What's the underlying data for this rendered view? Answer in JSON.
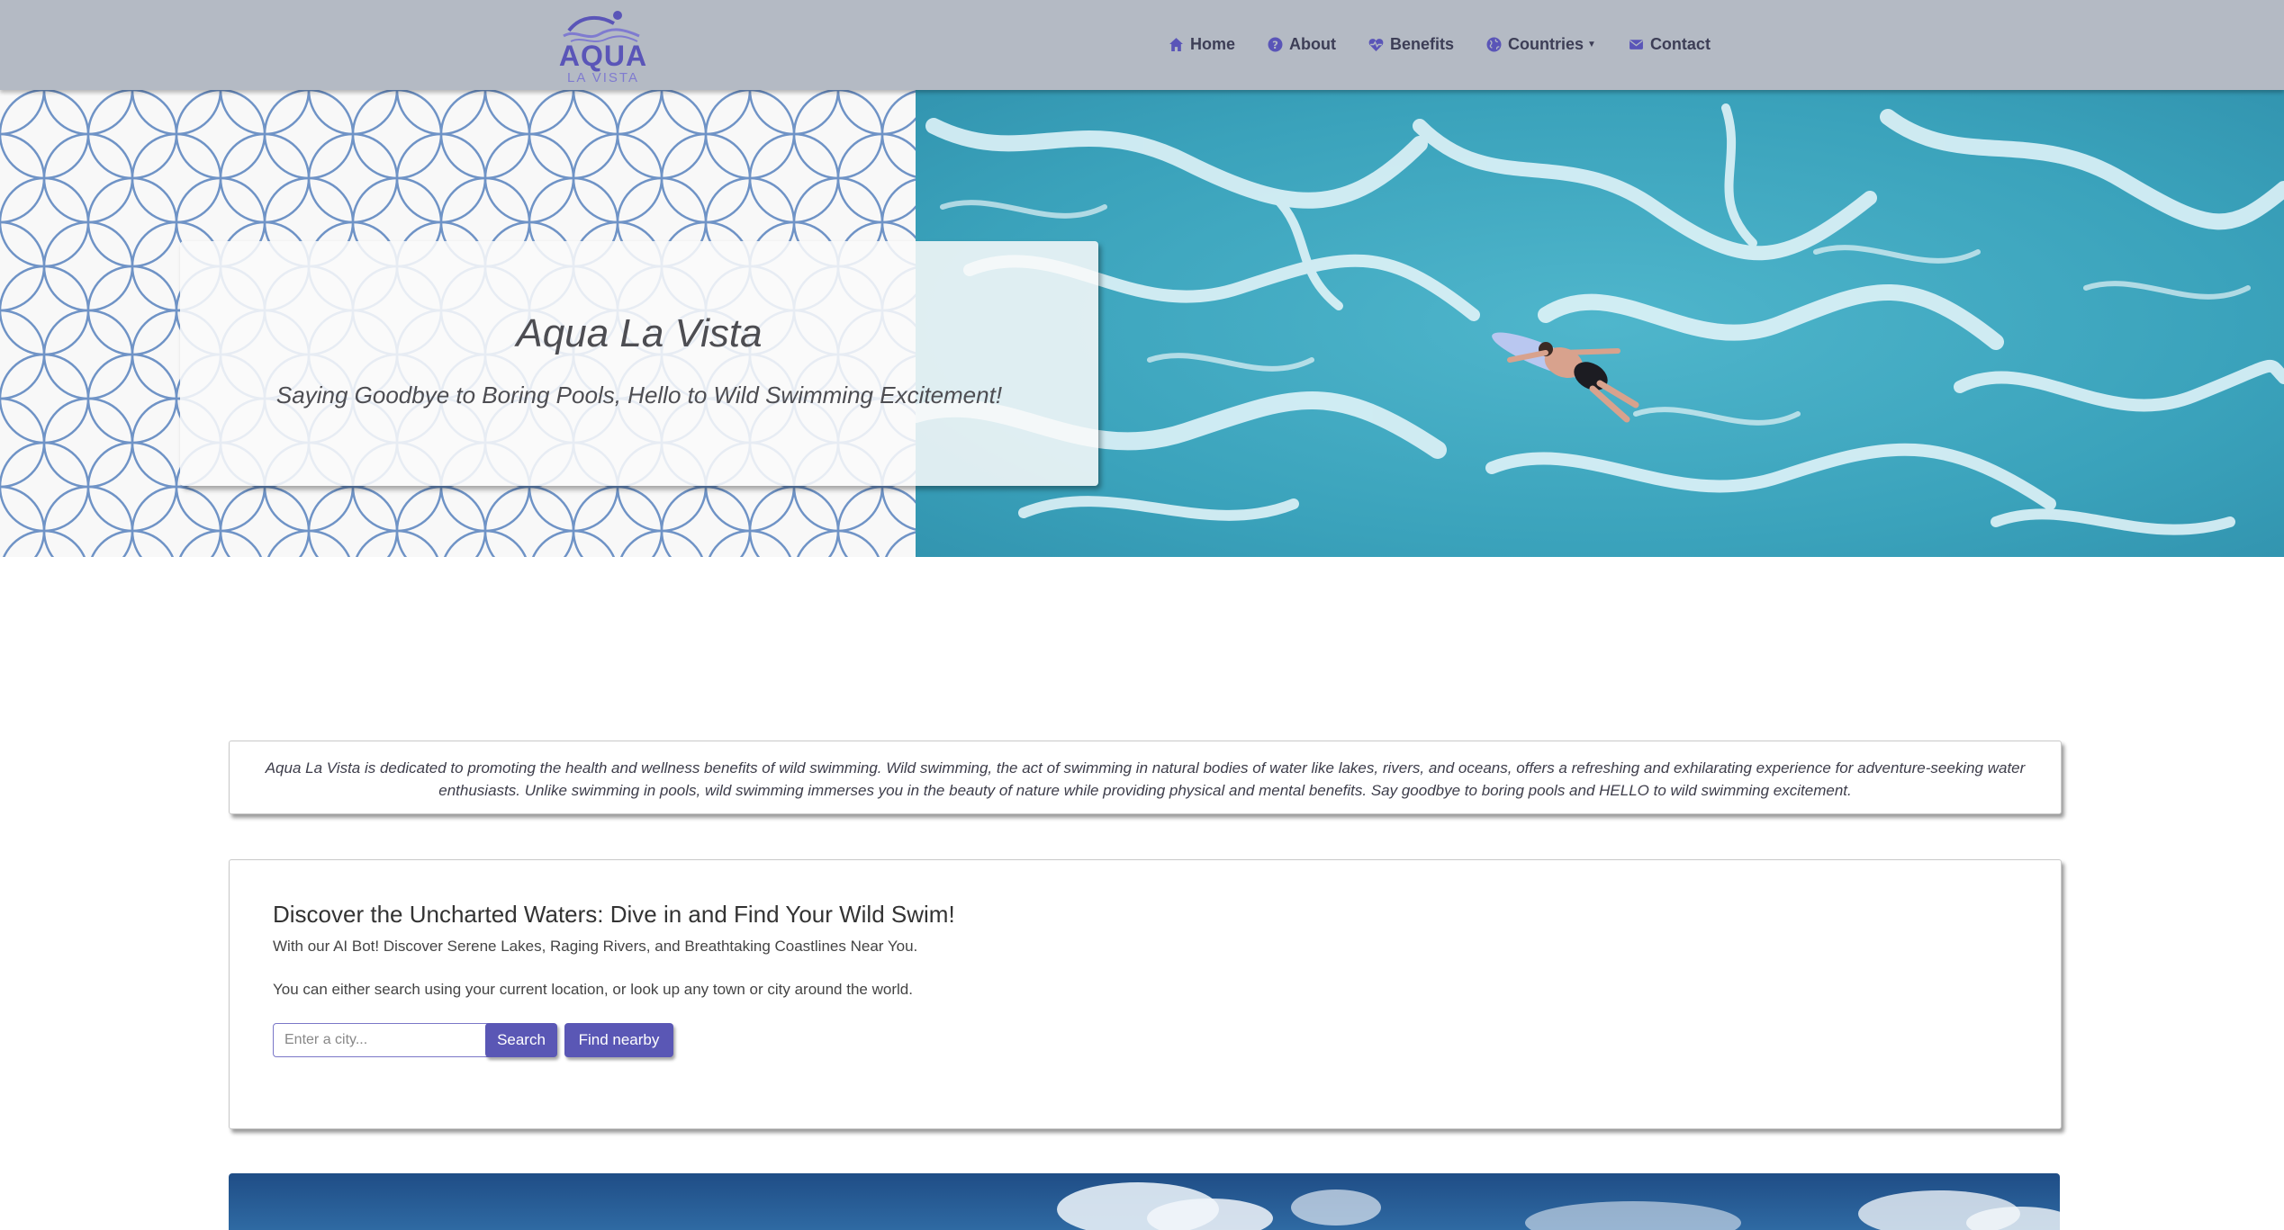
{
  "brand": {
    "title": "AQUA",
    "subtitle": "LA VISTA"
  },
  "nav": {
    "items": [
      {
        "label": "Home",
        "icon": "home-icon"
      },
      {
        "label": "About",
        "icon": "question-circle-icon"
      },
      {
        "label": "Benefits",
        "icon": "heart-pulse-icon"
      },
      {
        "label": "Countries",
        "icon": "globe-icon"
      },
      {
        "label": "Contact",
        "icon": "envelope-icon"
      }
    ]
  },
  "hero": {
    "title": "Aqua La Vista",
    "subtitle": "Saying Goodbye to Boring Pools, Hello to Wild Swimming Excitement!"
  },
  "intro": {
    "text": "Aqua La Vista is dedicated to promoting the health and wellness benefits of wild swimming. Wild swimming, the act of swimming in natural bodies of water like lakes, rivers, and oceans, offers a refreshing and exhilarating experience for adventure-seeking water enthusiasts. Unlike swimming in pools, wild swimming immerses you in the beauty of nature while providing physical and mental benefits. Say goodbye to boring pools and HELLO to wild swimming excitement."
  },
  "discover": {
    "title": "Discover the Uncharted Waters: Dive in and Find Your Wild Swim!",
    "line1": "With our AI Bot! Discover Serene Lakes, Raging Rivers, and Breathtaking Coastlines Near You.",
    "line2": "You can either search using your current location, or look up any town or city around the world.",
    "search": {
      "placeholder": "Enter a city...",
      "value": ""
    },
    "search_button": "Search",
    "nearby_button": "Find nearby"
  },
  "colors": {
    "navbar": "#b4bac4",
    "accent": "#5a57b5",
    "pattern_stroke": "#6f93c6",
    "sea": "#3fa6bd"
  }
}
